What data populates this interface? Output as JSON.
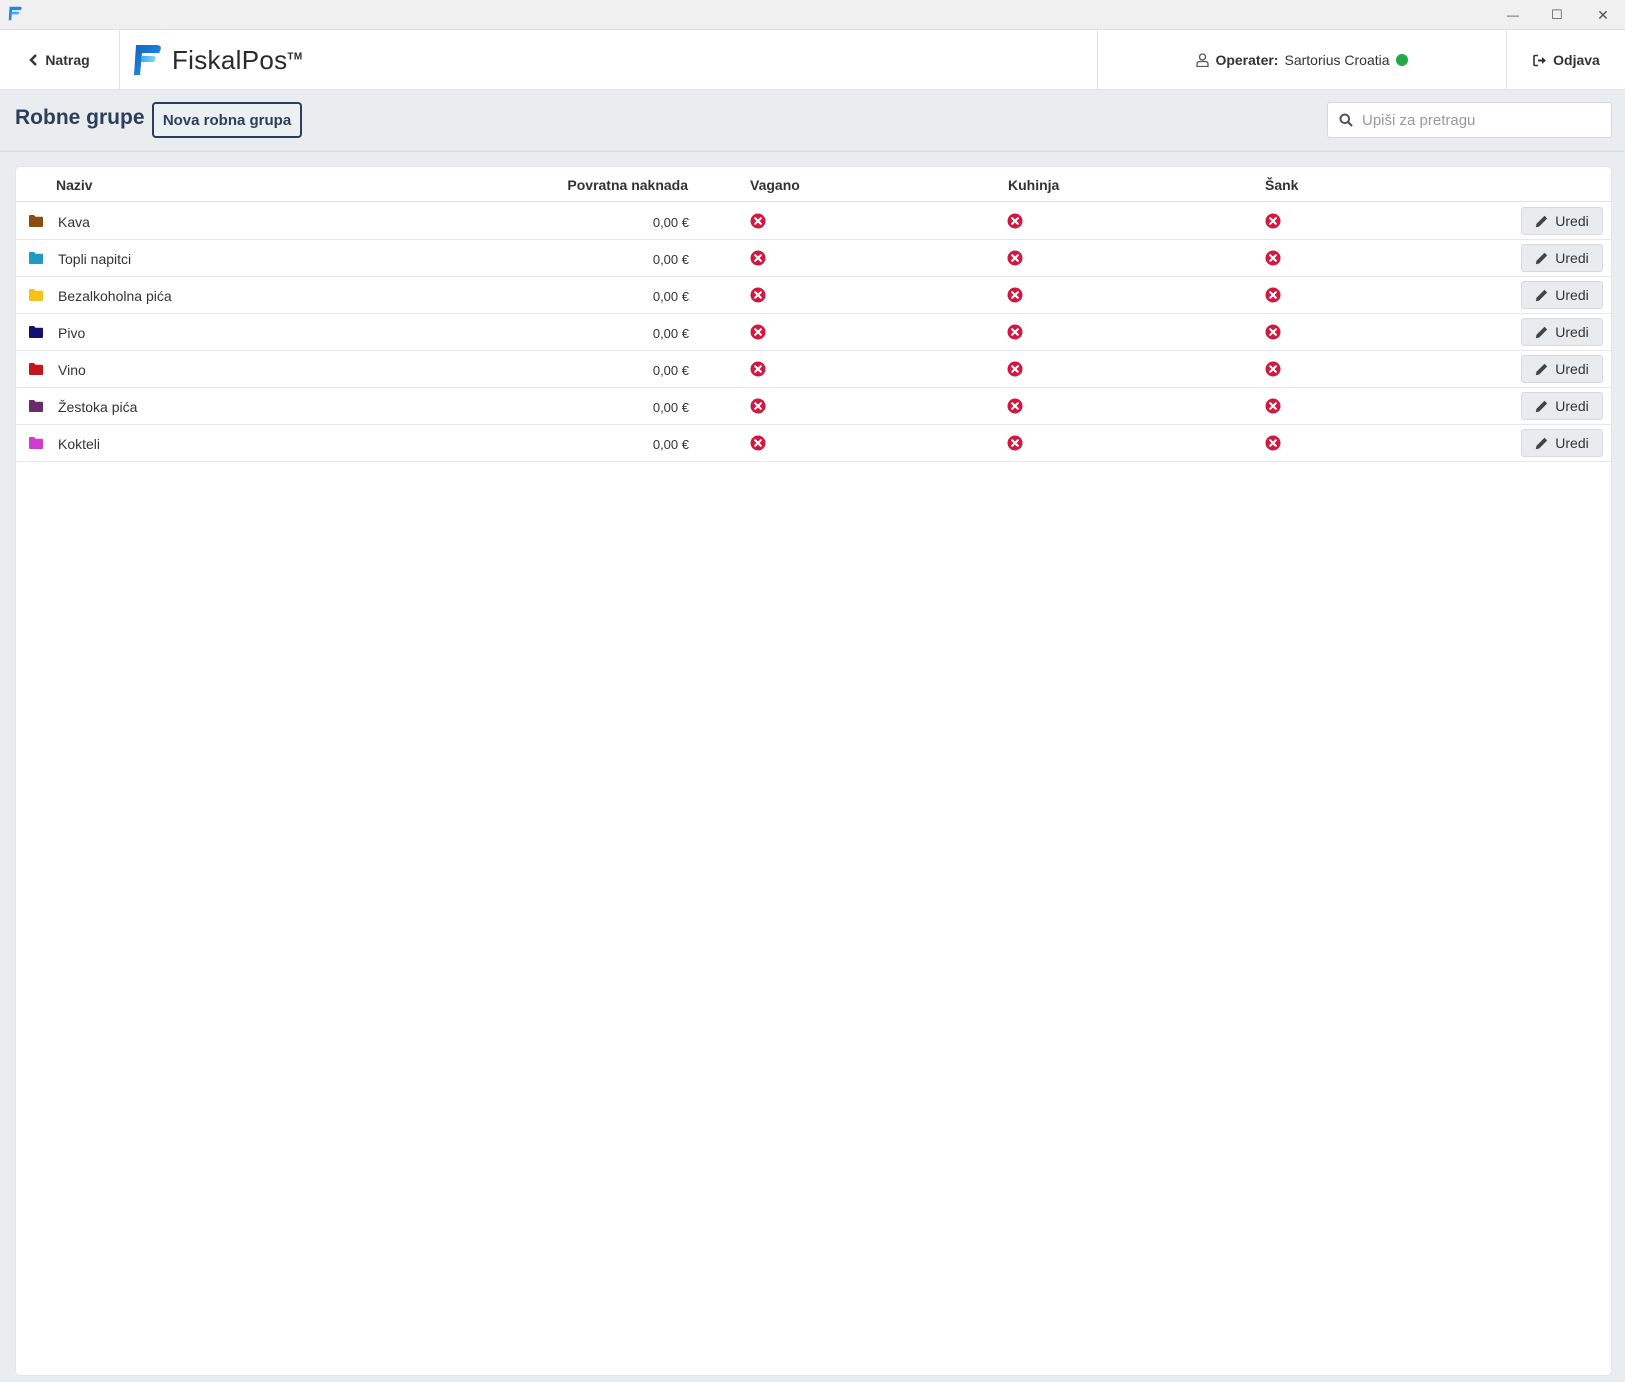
{
  "window": {
    "minimize_glyph": "—",
    "maximize_glyph": "☐",
    "close_glyph": "✕"
  },
  "header": {
    "back_label": "Natrag",
    "logo_text": "FiskalPos",
    "logo_tm": "TM",
    "operator_label": "Operater:",
    "operator_name": "Sartorius Croatia",
    "operator_status_color": "#22a845",
    "logout_label": "Odjava"
  },
  "toolbar": {
    "title": "Robne grupe",
    "new_button_label": "Nova robna grupa",
    "search_placeholder": "Upiši za pretragu"
  },
  "table": {
    "columns": {
      "naziv": "Naziv",
      "povratna": "Povratna naknada",
      "vagano": "Vagano",
      "kuhinja": "Kuhinja",
      "sank": "Šank"
    },
    "edit_label": "Uredi",
    "rows": [
      {
        "name": "Kava",
        "amount": "0,00 €",
        "color": "#8b4c10",
        "vagano": false,
        "kuhinja": false,
        "sank": false
      },
      {
        "name": "Topli napitci",
        "amount": "0,00 €",
        "color": "#1f9ac4",
        "vagano": false,
        "kuhinja": false,
        "sank": false
      },
      {
        "name": "Bezalkoholna pića",
        "amount": "0,00 €",
        "color": "#f6c21a",
        "vagano": false,
        "kuhinja": false,
        "sank": false
      },
      {
        "name": "Pivo",
        "amount": "0,00 €",
        "color": "#14106e",
        "vagano": false,
        "kuhinja": false,
        "sank": false
      },
      {
        "name": "Vino",
        "amount": "0,00 €",
        "color": "#c4171d",
        "vagano": false,
        "kuhinja": false,
        "sank": false
      },
      {
        "name": "Žestoka pića",
        "amount": "0,00 €",
        "color": "#6b2a6a",
        "vagano": false,
        "kuhinja": false,
        "sank": false
      },
      {
        "name": "Kokteli",
        "amount": "0,00 €",
        "color": "#d03ccd",
        "vagano": false,
        "kuhinja": false,
        "sank": false
      }
    ]
  },
  "colors": {
    "accent": "#2d3e5c",
    "false_icon": "#d3173f",
    "logo_blue": "#1e88e5"
  }
}
